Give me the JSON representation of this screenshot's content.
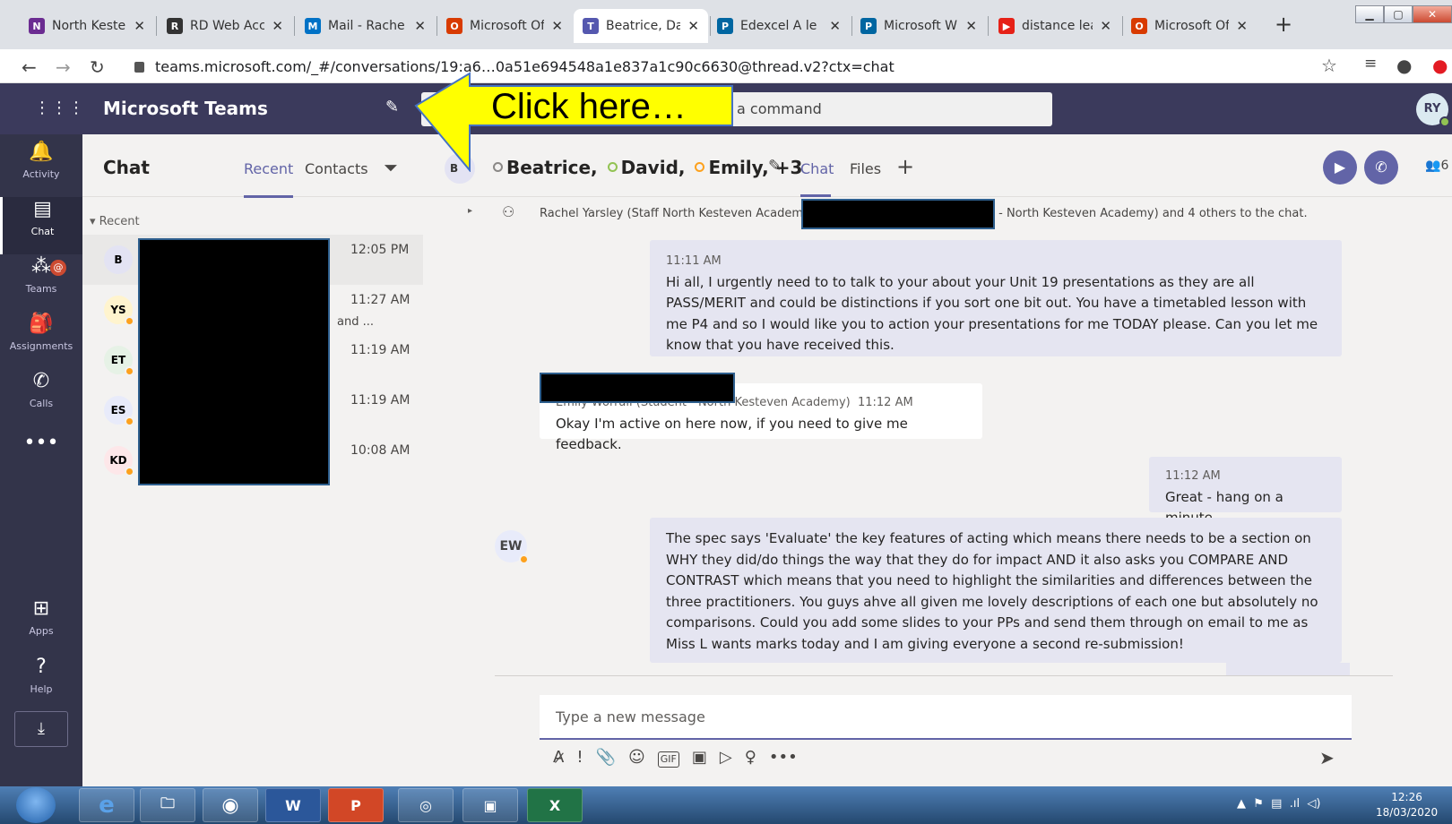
{
  "browser": {
    "tabs": [
      {
        "label": "North Keste",
        "color": "#6b2c91",
        "glyph": "N"
      },
      {
        "label": "RD Web Acc",
        "color": "#333333",
        "glyph": "R"
      },
      {
        "label": "Mail - Rache",
        "color": "#0072c6",
        "glyph": "M"
      },
      {
        "label": "Microsoft Of",
        "color": "#d83b01",
        "glyph": "O"
      },
      {
        "label": "Beatrice, Dav",
        "color": "#5558af",
        "glyph": "T"
      },
      {
        "label": "Edexcel A le",
        "color": "#0066a1",
        "glyph": "P"
      },
      {
        "label": "Microsoft W",
        "color": "#0066a1",
        "glyph": "P"
      },
      {
        "label": "distance lea",
        "color": "#e62117",
        "glyph": "▶"
      },
      {
        "label": "Microsoft Of",
        "color": "#d83b01",
        "glyph": "O"
      }
    ],
    "url": "teams.microsoft.com/_#/conversations/19:a6…0a51e694548a1e837a1c90c6630@thread.v2?ctx=chat"
  },
  "teams": {
    "app_title": "Microsoft Teams",
    "search_placeholder": "a command",
    "user_initials": "RY"
  },
  "rail": [
    {
      "label": "Activity",
      "icon": "bell-icon",
      "glyph": "🔔"
    },
    {
      "label": "Chat",
      "icon": "chat-icon",
      "glyph": "▤"
    },
    {
      "label": "Teams",
      "icon": "teams-icon",
      "glyph": "⁂"
    },
    {
      "label": "Assignments",
      "icon": "assignments-icon",
      "glyph": "🎒"
    },
    {
      "label": "Calls",
      "icon": "phone-icon",
      "glyph": "✆"
    },
    {
      "label": "",
      "icon": "more-icon",
      "glyph": "•••"
    },
    {
      "label": "Apps",
      "icon": "apps-icon",
      "glyph": "⊞"
    },
    {
      "label": "Help",
      "icon": "help-icon",
      "glyph": "?"
    }
  ],
  "chat_panel": {
    "title": "Chat",
    "tab_recent": "Recent",
    "tab_contacts": "Contacts",
    "section": "Recent",
    "items": [
      {
        "initials": "B",
        "time": "12:05 PM",
        "preview": ""
      },
      {
        "initials": "YS",
        "time": "11:27 AM",
        "preview": "and ..."
      },
      {
        "initials": "ET",
        "time": "11:19 AM",
        "preview": ""
      },
      {
        "initials": "ES",
        "time": "11:19 AM",
        "preview": ""
      },
      {
        "initials": "KD",
        "time": "10:08 AM",
        "preview": ""
      }
    ]
  },
  "conversation": {
    "title_parts": [
      "Beatrice,",
      "David,",
      "Emily,",
      "+3"
    ],
    "tab_chat": "Chat",
    "tab_files": "Files",
    "people_count": "6",
    "system_left": "Rachel Yarsley (Staff North Kesteven Academ",
    "system_right": " - North Kesteven Academy) and 4 others to the chat.",
    "messages": [
      {
        "time": "11:11 AM",
        "text": "Hi all, I urgently need to to talk to your about your Unit 19 presentations as they are all PASS/MERIT and could be distinctions if you sort one bit out.  You have a timetabled lesson with me P4 and so I would like you to action your presentations for me TODAY please.  Can you let me know that you have received this."
      },
      {
        "sender": "Emily Worrall (Student - North Kesteven Academy)",
        "time": "11:12 AM",
        "text": "Okay I'm active on here now, if you need to give me feedback.",
        "initials": "EW"
      },
      {
        "time": "11:12 AM",
        "text": "Great - hang on a minute"
      },
      {
        "text": "The spec says 'Evaluate' the key features of acting which means there needs to be a section on WHY they did/do things the way that they do for impact AND it also asks you COMPARE AND CONTRAST which means that you need to highlight the similarities and differences between the three practitioners.  You guys ahve all given me lovely descriptions of each one but absolutely no comparisons.  Could you add some slides to your PPs and send them through on email to me as Miss L wants marks today and I am giving everyone a second re-submission!"
      }
    ],
    "compose_placeholder": "Type a new message"
  },
  "callout": {
    "text": "Click here…",
    "fill": "#ffff00"
  },
  "taskbar": {
    "time": "12:26",
    "date": "18/03/2020"
  }
}
